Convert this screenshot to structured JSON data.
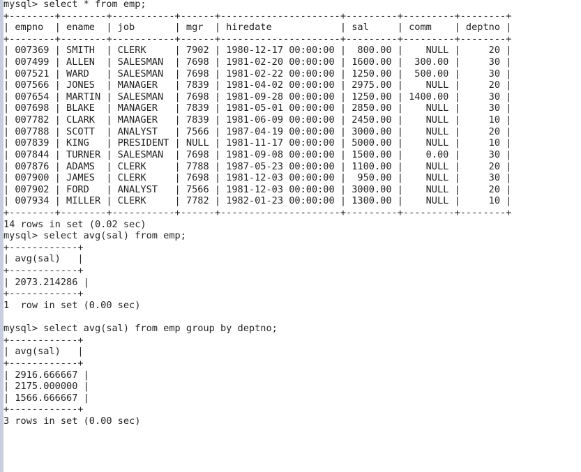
{
  "terminal": {
    "prompt": "mysql> ",
    "background_color": "#ffffff",
    "text_color": "#242424",
    "gutter_color": "#c7cedd"
  },
  "sessions": [
    {
      "id": "query-1",
      "command": "select * from emp;",
      "result_table": {
        "columns": [
          "empno",
          "ename",
          "job",
          "mgr",
          "hiredate",
          "sal",
          "comm",
          "deptno"
        ],
        "widths": [
          8,
          8,
          11,
          6,
          21,
          9,
          9,
          8
        ],
        "aligns": [
          "right",
          "left",
          "left",
          "right",
          "left",
          "right",
          "right",
          "right"
        ],
        "rows": [
          [
            "007369",
            "SMITH",
            "CLERK",
            "7902",
            "1980-12-17 00:00:00",
            "800.00",
            "NULL",
            "20"
          ],
          [
            "007499",
            "ALLEN",
            "SALESMAN",
            "7698",
            "1981-02-20 00:00:00",
            "1600.00",
            "300.00",
            "30"
          ],
          [
            "007521",
            "WARD",
            "SALESMAN",
            "7698",
            "1981-02-22 00:00:00",
            "1250.00",
            "500.00",
            "30"
          ],
          [
            "007566",
            "JONES",
            "MANAGER",
            "7839",
            "1981-04-02 00:00:00",
            "2975.00",
            "NULL",
            "20"
          ],
          [
            "007654",
            "MARTIN",
            "SALESMAN",
            "7698",
            "1981-09-28 00:00:00",
            "1250.00",
            "1400.00",
            "30"
          ],
          [
            "007698",
            "BLAKE",
            "MANAGER",
            "7839",
            "1981-05-01 00:00:00",
            "2850.00",
            "NULL",
            "30"
          ],
          [
            "007782",
            "CLARK",
            "MANAGER",
            "7839",
            "1981-06-09 00:00:00",
            "2450.00",
            "NULL",
            "10"
          ],
          [
            "007788",
            "SCOTT",
            "ANALYST",
            "7566",
            "1987-04-19 00:00:00",
            "3000.00",
            "NULL",
            "20"
          ],
          [
            "007839",
            "KING",
            "PRESIDENT",
            "NULL",
            "1981-11-17 00:00:00",
            "5000.00",
            "NULL",
            "10"
          ],
          [
            "007844",
            "TURNER",
            "SALESMAN",
            "7698",
            "1981-09-08 00:00:00",
            "1500.00",
            "0.00",
            "30"
          ],
          [
            "007876",
            "ADAMS",
            "CLERK",
            "7788",
            "1987-05-23 00:00:00",
            "1100.00",
            "NULL",
            "20"
          ],
          [
            "007900",
            "JAMES",
            "CLERK",
            "7698",
            "1981-12-03 00:00:00",
            "950.00",
            "NULL",
            "30"
          ],
          [
            "007902",
            "FORD",
            "ANALYST",
            "7566",
            "1981-12-03 00:00:00",
            "3000.00",
            "NULL",
            "20"
          ],
          [
            "007934",
            "MILLER",
            "CLERK",
            "7782",
            "1982-01-23 00:00:00",
            "1300.00",
            "NULL",
            "10"
          ]
        ]
      },
      "status": "14 rows in set (0.02 sec)",
      "blank_after": false
    },
    {
      "id": "query-2",
      "command": "select avg(sal) from emp;",
      "result_table": {
        "columns": [
          "avg(sal)"
        ],
        "widths": [
          12
        ],
        "aligns": [
          "right"
        ],
        "rows": [
          [
            "2073.214286"
          ]
        ]
      },
      "status": "1  row in set (0.00 sec)",
      "blank_after": true
    },
    {
      "id": "query-3",
      "command": "select avg(sal) from emp group by deptno;",
      "result_table": {
        "columns": [
          "avg(sal)"
        ],
        "widths": [
          12
        ],
        "aligns": [
          "right"
        ],
        "rows": [
          [
            "2916.666667"
          ],
          [
            "2175.000000"
          ],
          [
            "1566.666667"
          ]
        ]
      },
      "status": "3 rows in set (0.00 sec)",
      "blank_after": false
    }
  ]
}
